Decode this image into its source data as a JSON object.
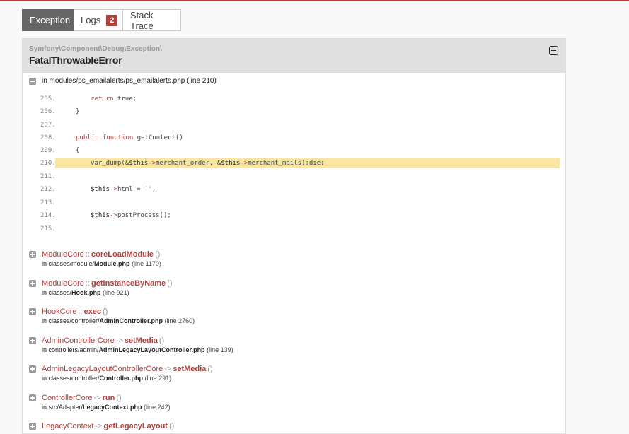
{
  "tabs": {
    "exception": "Exception",
    "logs": "Logs",
    "logs_count": "2",
    "stack_trace": "Stack Trace"
  },
  "exception": {
    "namespace": "Symfony\\Component\\Debug\\Exception\\",
    "class": "FatalThrowableError",
    "location_prefix": "in modules/ps_emailalerts/",
    "location_file": "ps_emailalerts.php",
    "location_line": "(line 210)"
  },
  "code": [
    {
      "ln": "205.",
      "src": "return true;"
    },
    {
      "ln": "206.",
      "src": "}"
    },
    {
      "ln": "207.",
      "src": ""
    },
    {
      "ln": "208.",
      "src": "public function getContent()"
    },
    {
      "ln": "209.",
      "src": "{"
    },
    {
      "ln": "210.",
      "src": "var_dump(&$this->merchant_order, &$this->merchant_mails);die;"
    },
    {
      "ln": "211.",
      "src": ""
    },
    {
      "ln": "212.",
      "src": "$this->html = '';"
    },
    {
      "ln": "213.",
      "src": ""
    },
    {
      "ln": "214.",
      "src": "$this->postProcess();"
    },
    {
      "ln": "215.",
      "src": ""
    }
  ],
  "trace": [
    {
      "class": "ModuleCore",
      "sep": "::",
      "method": "coreLoadModule",
      "args": "()",
      "path": "in classes/module/",
      "file": "Module.php",
      "line": "(line 1170)"
    },
    {
      "class": "ModuleCore",
      "sep": "::",
      "method": "getInstanceByName",
      "args": "()",
      "path": "in classes/",
      "file": "Hook.php",
      "line": "(line 921)"
    },
    {
      "class": "HookCore",
      "sep": "::",
      "method": "exec",
      "args": "()",
      "path": "in classes/controller/",
      "file": "AdminController.php",
      "line": "(line 2760)"
    },
    {
      "class": "AdminControllerCore",
      "sep": "->",
      "method": "setMedia",
      "args": "()",
      "path": "in controllers/admin/",
      "file": "AdminLegacyLayoutController.php",
      "line": "(line 139)"
    },
    {
      "class": "AdminLegacyLayoutControllerCore",
      "sep": "->",
      "method": "setMedia",
      "args": "()",
      "path": "in classes/controller/",
      "file": "Controller.php",
      "line": "(line 291)"
    },
    {
      "class": "ControllerCore",
      "sep": "->",
      "method": "run",
      "args": "()",
      "path": "in src/Adapter/",
      "file": "LegacyContext.php",
      "line": "(line 242)"
    },
    {
      "class": "LegacyContext",
      "sep": "->",
      "method": "getLegacyLayout",
      "args": "()",
      "path": "",
      "file": "",
      "line": ""
    }
  ],
  "colors": {
    "accent": "#b0413e",
    "highlight": "#fae6a3",
    "header_bg": "#e0e0e0",
    "active_tab": "#666666"
  }
}
